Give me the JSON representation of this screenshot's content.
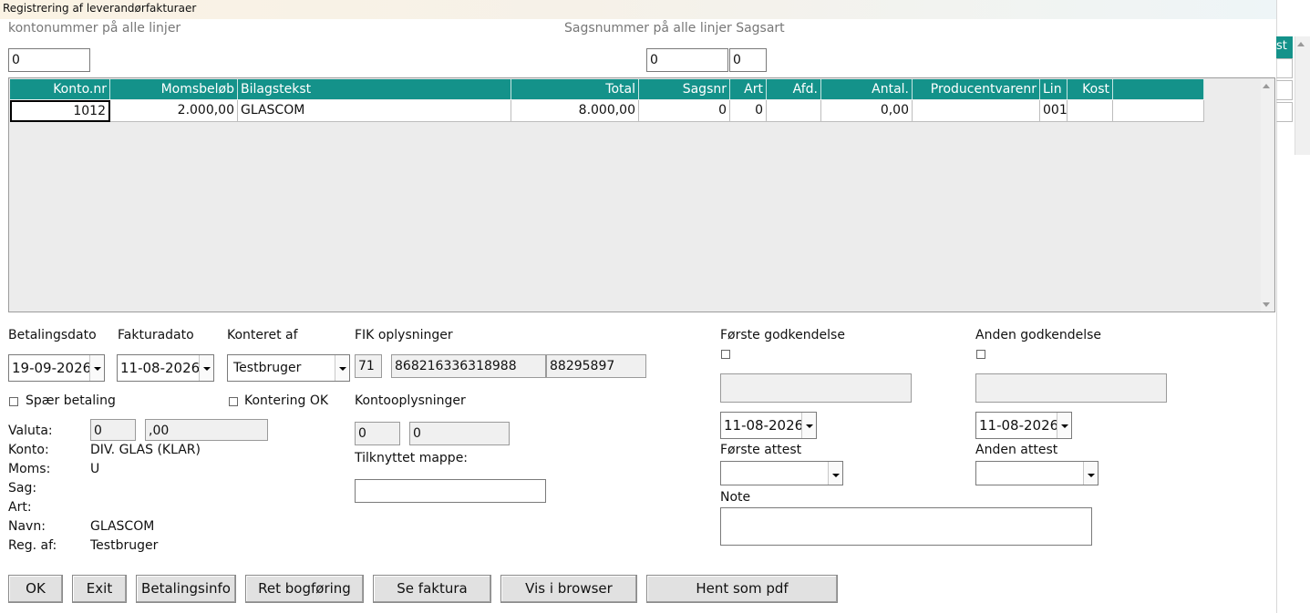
{
  "window": {
    "title": "Registrering af leverandørfakturaer"
  },
  "top": {
    "kontonummer_label": "kontonummer på alle linjer",
    "kontonummer_value": "0",
    "sagsnummer_label": "Sagsnummer på alle linjer",
    "sagsart_label": "Sagsart",
    "sagsnummer_value": "0",
    "sagsart_value": "0"
  },
  "grid": {
    "columns": [
      "Konto.nr",
      "Momsbeløb",
      "Bilagstekst",
      "Total",
      "Sagsnr",
      "Art",
      "Afd.",
      "Antal.",
      "Producentvarenr",
      "Lin",
      "Kost",
      ""
    ],
    "rows": [
      [
        "1012",
        "2.000,00",
        "GLASCOM",
        "8.000,00",
        "0",
        "0",
        "",
        "0,00",
        "",
        "001",
        "",
        ""
      ]
    ]
  },
  "fields": {
    "betalingsdato_label": "Betalingsdato",
    "betalingsdato": "19-09-2026",
    "fakturadato_label": "Fakturadato",
    "fakturadato": "11-08-2026",
    "konteret_af_label": "Konteret af",
    "konteret_af": "Testbruger",
    "fik_label": "FIK oplysninger",
    "fik_1": "71",
    "fik_2": "868216336318988",
    "fik_3": "88295897",
    "spaer_betaling": "Spær betaling",
    "kontering_ok": "Kontering OK",
    "kontooplysninger_label": "Kontooplysninger",
    "kontoopl_1": "0",
    "kontoopl_2": "0",
    "tilknyttet_label": "Tilknyttet mappe:",
    "tilknyttet_value": ""
  },
  "info": {
    "valuta_label": "Valuta:",
    "valuta_1": "0",
    "valuta_2": ",00",
    "konto_label": "Konto:",
    "konto_value": "DIV. GLAS (KLAR)",
    "moms_label": "Moms:",
    "moms_value": "U",
    "sag_label": "Sag:",
    "art_label": "Art:",
    "navn_label": "Navn:",
    "navn_value": "GLASCOM",
    "regaf_label": "Reg. af:",
    "regaf_value": "Testbruger"
  },
  "approval": {
    "foerste_label": "Første godkendelse",
    "anden_label": "Anden godkendelse",
    "foerste_date": "11-08-2026",
    "anden_date": "11-08-2026",
    "foerste_attest_label": "Første attest",
    "anden_attest_label": "Anden attest",
    "note_label": "Note"
  },
  "buttons": {
    "ok": "OK",
    "exit": "Exit",
    "betalingsinfo": "Betalingsinfo",
    "ret_bogfoering": "Ret bogføring",
    "se_faktura": "Se faktura",
    "vis_browser": "Vis i browser",
    "hent_pdf": "Hent som pdf"
  },
  "side": {
    "partial_header": "st"
  },
  "colors": {
    "accent": "#14928a"
  }
}
